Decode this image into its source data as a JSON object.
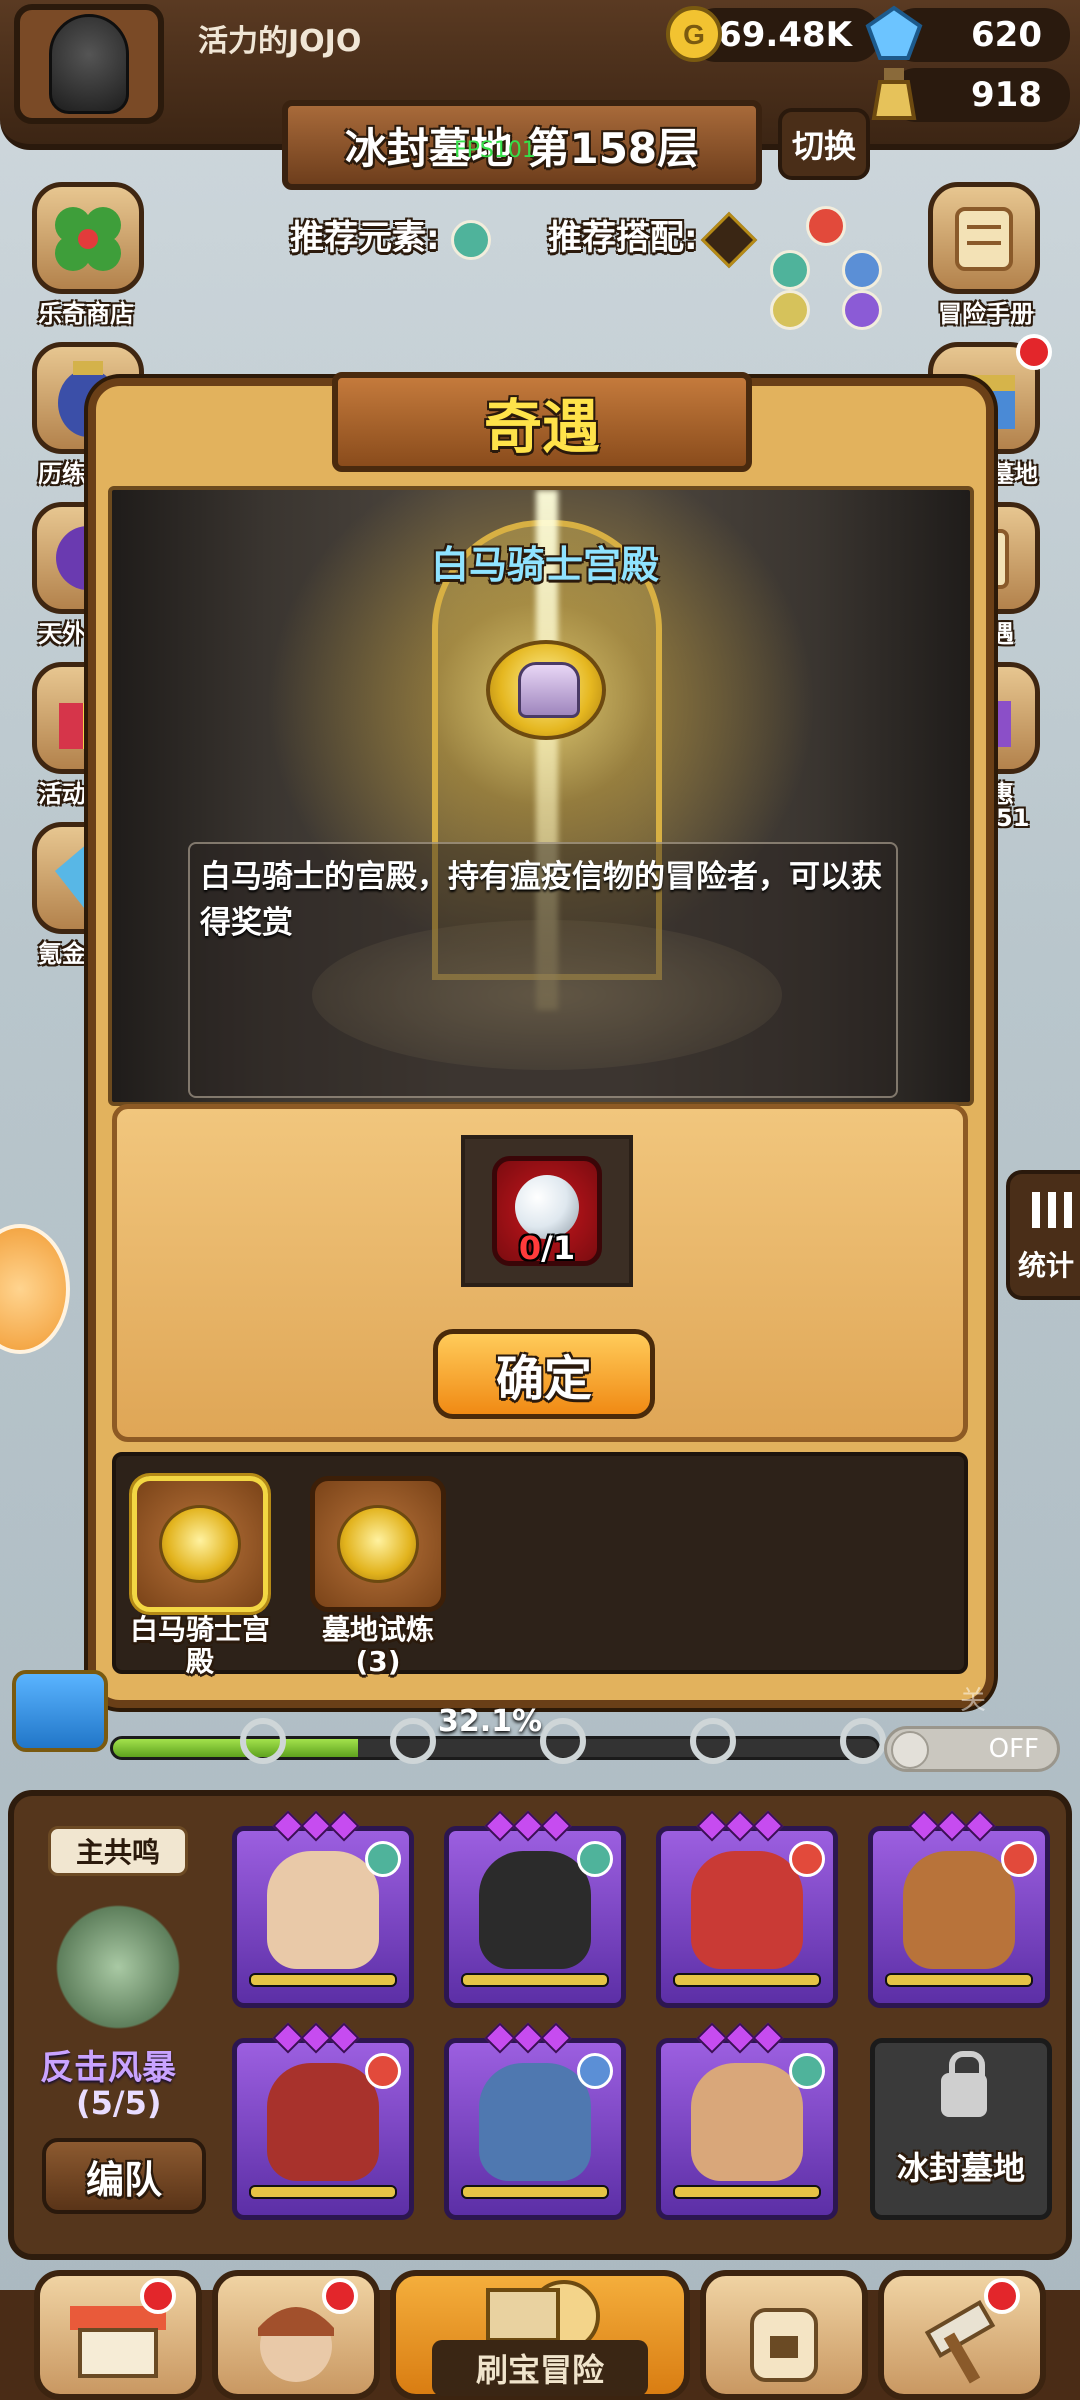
{
  "header": {
    "player_name": "活力的JOJO",
    "gold": "369.48K",
    "gems": "620",
    "potions": "918"
  },
  "level": {
    "title": "冰封墓地 第158层",
    "switch_label": "切换",
    "fps": "FPS101",
    "recommended_element_label": "推荐元素:",
    "recommended_combo_label": "推荐搭配:"
  },
  "side_menu": {
    "left": [
      {
        "label": "乐奇商店",
        "icon": "clover-icon"
      },
      {
        "label": "历练",
        "icon": "vase-icon"
      },
      {
        "label": "天外",
        "icon": "portal-icon"
      },
      {
        "label": "活动",
        "icon": "gift-icon"
      },
      {
        "label": "氪金",
        "icon": "diamond-icon"
      }
    ],
    "right": [
      {
        "label": "冒险手册",
        "icon": "scroll-icon"
      },
      {
        "label": "墓地",
        "icon": "chest-icon"
      },
      {
        "label": "遇",
        "icon": "list-icon"
      },
      {
        "label": "惠",
        "icon": "box-icon"
      },
      {
        "label": "51",
        "icon": "timer-icon"
      }
    ]
  },
  "dialog": {
    "title": "奇遇",
    "scene_title": "白马骑士宫殿",
    "description": "白马骑士的宫殿，持有瘟疫信物的冒险者，可以获得奖赏",
    "reward": {
      "have": "0",
      "need": "/1",
      "icon": "pearl-icon"
    },
    "confirm_label": "确定",
    "encounters": [
      {
        "label": "白马骑士宫殿",
        "selected": true,
        "icon": "armor-medal-icon"
      },
      {
        "label": "墓地试炼\n(3)",
        "selected": false,
        "icon": "book-medal-icon"
      }
    ]
  },
  "progress": {
    "percent_text": "32.1%",
    "value": 0.321,
    "toggle_label": "OFF",
    "faded_label": "关"
  },
  "stats_label": "统计",
  "party": {
    "resonance_tag": "主共鸣",
    "skill_name": "反击风暴",
    "skill_count": "(5/5)",
    "team_button": "编队",
    "locked_label": "冰封墓地",
    "heroes": [
      {
        "name": "hero-scarred-man",
        "element": "#4fb39b",
        "face": "#e9c9a8"
      },
      {
        "name": "hero-black-knight",
        "element": "#4fb39b",
        "face": "#2b2b2b"
      },
      {
        "name": "hero-red-demon",
        "element": "#e24a3b",
        "face": "#c93a35"
      },
      {
        "name": "hero-turban-man",
        "element": "#e24a3b",
        "face": "#b8733a"
      },
      {
        "name": "hero-oni-mask",
        "element": "#e24a3b",
        "face": "#a8322c"
      },
      {
        "name": "hero-goggle-diver",
        "element": "#5b8fd6",
        "face": "#4f78b0"
      },
      {
        "name": "hero-warrior-topknot",
        "element": "#4fb39b",
        "face": "#d9a77a"
      }
    ]
  },
  "bottom_nav": {
    "adventure_label": "刷宝冒险"
  }
}
